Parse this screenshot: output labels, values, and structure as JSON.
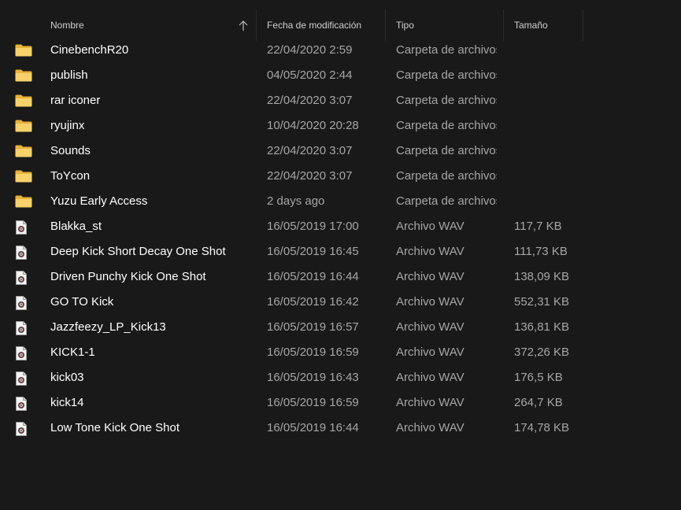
{
  "columns": {
    "name": "Nombre",
    "date": "Fecha de modificación",
    "type": "Tipo",
    "size": "Tamaño"
  },
  "colors": {
    "background": "#191919",
    "folder": "#f3c74e",
    "text_primary": "#ffffff",
    "text_secondary": "#a6a6a6"
  },
  "items": [
    {
      "icon": "folder-icon",
      "name": "CinebenchR20",
      "date": "22/04/2020 2:59",
      "type": "Carpeta de archivos",
      "size": ""
    },
    {
      "icon": "folder-icon",
      "name": "publish",
      "date": "04/05/2020 2:44",
      "type": "Carpeta de archivos",
      "size": ""
    },
    {
      "icon": "folder-icon",
      "name": "rar iconer",
      "date": "22/04/2020 3:07",
      "type": "Carpeta de archivos",
      "size": ""
    },
    {
      "icon": "folder-icon",
      "name": "ryujinx",
      "date": "10/04/2020 20:28",
      "type": "Carpeta de archivos",
      "size": ""
    },
    {
      "icon": "folder-icon",
      "name": "Sounds",
      "date": "22/04/2020 3:07",
      "type": "Carpeta de archivos",
      "size": ""
    },
    {
      "icon": "folder-icon",
      "name": "ToYcon",
      "date": "22/04/2020 3:07",
      "type": "Carpeta de archivos",
      "size": ""
    },
    {
      "icon": "folder-icon",
      "name": "Yuzu Early Access",
      "date": "2 days ago",
      "type": "Carpeta de archivos",
      "size": ""
    },
    {
      "icon": "audio-file-icon",
      "name": "Blakka_st",
      "date": "16/05/2019 17:00",
      "type": "Archivo WAV",
      "size": "117,7 KB"
    },
    {
      "icon": "audio-file-icon",
      "name": "Deep Kick Short Decay One Shot",
      "date": "16/05/2019 16:45",
      "type": "Archivo WAV",
      "size": "111,73 KB"
    },
    {
      "icon": "audio-file-icon",
      "name": "Driven Punchy Kick One Shot",
      "date": "16/05/2019 16:44",
      "type": "Archivo WAV",
      "size": "138,09 KB"
    },
    {
      "icon": "audio-file-icon",
      "name": "GO TO Kick",
      "date": "16/05/2019 16:42",
      "type": "Archivo WAV",
      "size": "552,31 KB"
    },
    {
      "icon": "audio-file-icon",
      "name": "Jazzfeezy_LP_Kick13",
      "date": "16/05/2019 16:57",
      "type": "Archivo WAV",
      "size": "136,81 KB"
    },
    {
      "icon": "audio-file-icon",
      "name": "KICK1-1",
      "date": "16/05/2019 16:59",
      "type": "Archivo WAV",
      "size": "372,26 KB"
    },
    {
      "icon": "audio-file-icon",
      "name": "kick03",
      "date": "16/05/2019 16:43",
      "type": "Archivo WAV",
      "size": "176,5 KB"
    },
    {
      "icon": "audio-file-icon",
      "name": "kick14",
      "date": "16/05/2019 16:59",
      "type": "Archivo WAV",
      "size": "264,7 KB"
    },
    {
      "icon": "audio-file-icon",
      "name": "Low Tone Kick One Shot",
      "date": "16/05/2019 16:44",
      "type": "Archivo WAV",
      "size": "174,78 KB"
    }
  ]
}
